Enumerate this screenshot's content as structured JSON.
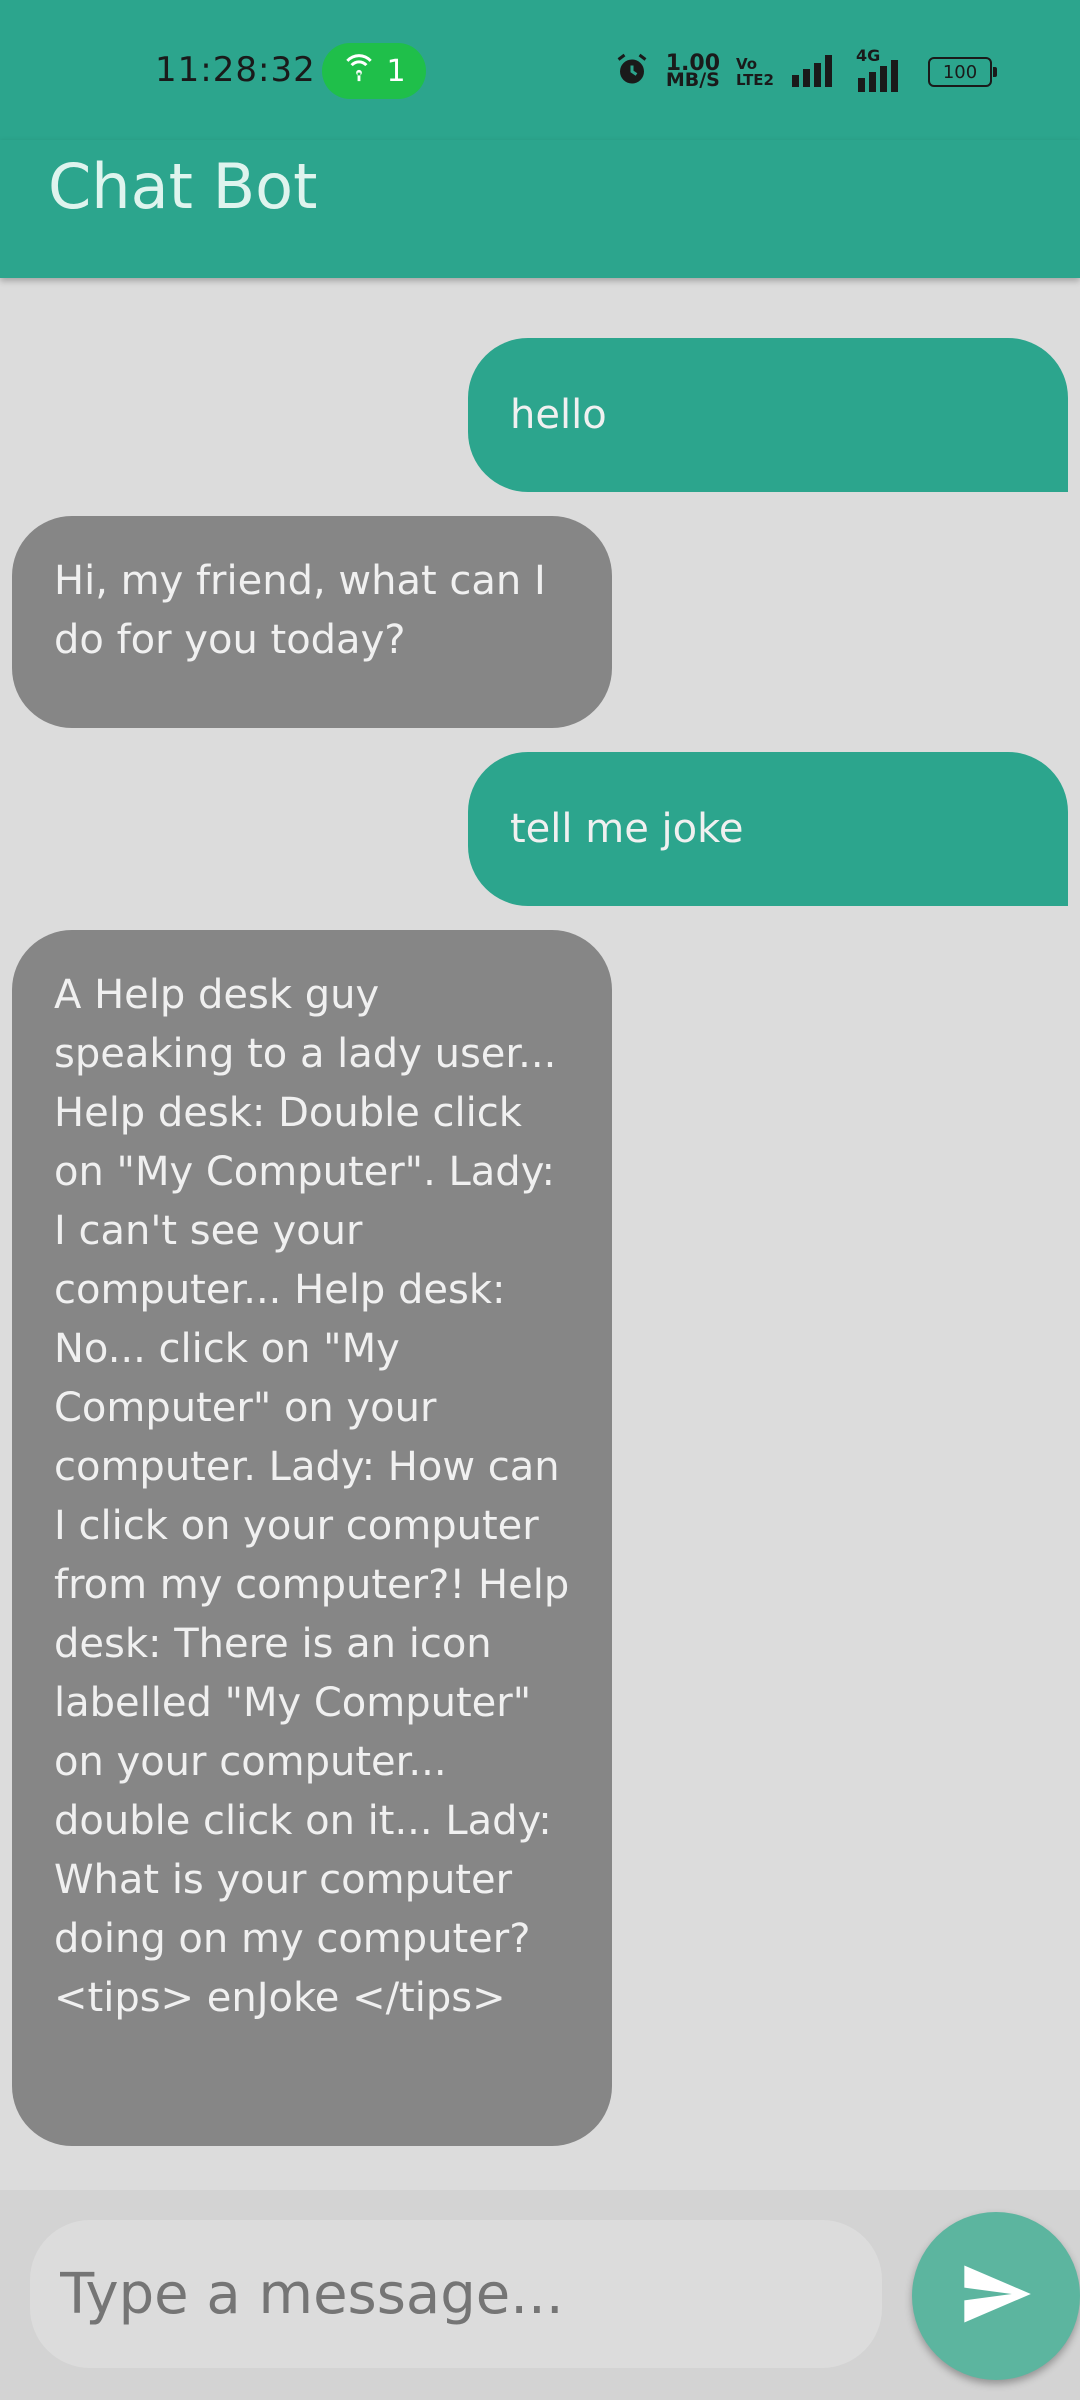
{
  "status_bar": {
    "time": "11:28:32",
    "hotspot_count": "1",
    "speed_value": "1.00",
    "speed_unit": "MB/S",
    "volte_top": "Vo",
    "volte_bottom": "LTE2",
    "network_type": "4G",
    "battery": "100"
  },
  "app_bar": {
    "title": "Chat Bot"
  },
  "messages": [
    {
      "sender": "user",
      "text": "hello"
    },
    {
      "sender": "bot",
      "text": "Hi, my friend, what can I do for you today?"
    },
    {
      "sender": "user",
      "text": "tell me joke"
    },
    {
      "sender": "bot",
      "text": "A Help desk guy speaking to a lady user... Help desk: Double click on \"My Computer\". Lady: I can't see your computer... Help desk: No... click on \"My Computer\" on your computer. Lady: How can I click on your computer from my computer?! Help desk: There is an icon labelled \"My Computer\" on your computer... double click on it... Lady: What is your computer doing on my computer?<tips> enJoke </tips>"
    }
  ],
  "input": {
    "placeholder": "Type a message..."
  },
  "icons": {
    "hotspot": "hotspot-icon",
    "alarm": "alarm-icon",
    "signal": "signal-icon",
    "send": "send-icon"
  },
  "colors": {
    "primary": "#2ca58d",
    "bot_bubble": "#868686",
    "background": "#dcdcdc",
    "send_button": "#5cb59f"
  }
}
